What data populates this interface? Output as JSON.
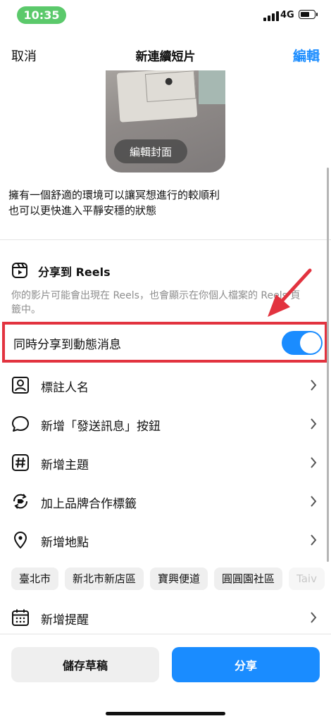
{
  "status_bar": {
    "time": "10:35",
    "network": "4G",
    "battery_level": 0.7
  },
  "header": {
    "cancel_label": "取消",
    "title": "新連續短片",
    "edit_label": "編輯"
  },
  "cover": {
    "edit_cover_label": "編輯封面"
  },
  "caption": {
    "line1": "擁有一個舒適的環境可以讓冥想進行的較順利",
    "line2": "也可以更快進入平靜安穩的狀態"
  },
  "reels": {
    "title": "分享到 Reels",
    "description": "你的影片可能會出現在 Reels，也會顯示在你個人檔案的 Reels 頁籤中。"
  },
  "share_to_feed": {
    "label": "同時分享到動態消息",
    "enabled": true
  },
  "options": [
    {
      "label": "標註人名",
      "icon": "person-tag-icon"
    },
    {
      "label": "新增「發送訊息」按鈕",
      "icon": "chat-bubble-icon"
    },
    {
      "label": "新增主題",
      "icon": "hashtag-icon"
    },
    {
      "label": "加上品牌合作標籤",
      "icon": "brand-tag-icon"
    },
    {
      "label": "新增地點",
      "icon": "location-pin-icon"
    }
  ],
  "location_chips": [
    "臺北市",
    "新北市新店區",
    "寶興便道",
    "圓圓園社區",
    "Taiv"
  ],
  "reminder": {
    "label": "新增提醒",
    "icon": "calendar-icon"
  },
  "bottom": {
    "draft_label": "儲存草稿",
    "share_label": "分享"
  },
  "colors": {
    "accent": "#1a8cff",
    "highlight": "#e2333f",
    "time_pill": "#5bc96b"
  }
}
